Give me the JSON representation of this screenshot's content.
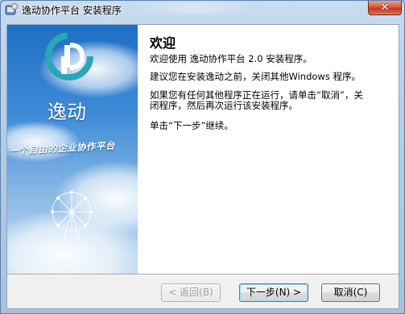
{
  "window": {
    "title": "逸动协作平台 安装程序",
    "close_glyph": "✕"
  },
  "side": {
    "brand": "逸动",
    "slogan": "一个自由的企业协作平台",
    "logo_letter": "D",
    "colors": {
      "sky_top": "#1f6fc4",
      "logo_teal": "#2aa6b8"
    }
  },
  "content": {
    "title": "欢迎",
    "line1": "欢迎使用 逸动协作平台 2.0 安装程序。",
    "line2": "建议您在安装逸动之前，关闭其他Windows 程序。",
    "line3a": "如果您有任何其他程序正在运行，请单击“取消”，关",
    "line3b": "闭程序，然后再次运行该安装程序。",
    "line4": "单击“下一步”继续。"
  },
  "buttons": {
    "back": "< 返回(B)",
    "next": "下一步(N) >",
    "cancel": "取消(C)"
  }
}
